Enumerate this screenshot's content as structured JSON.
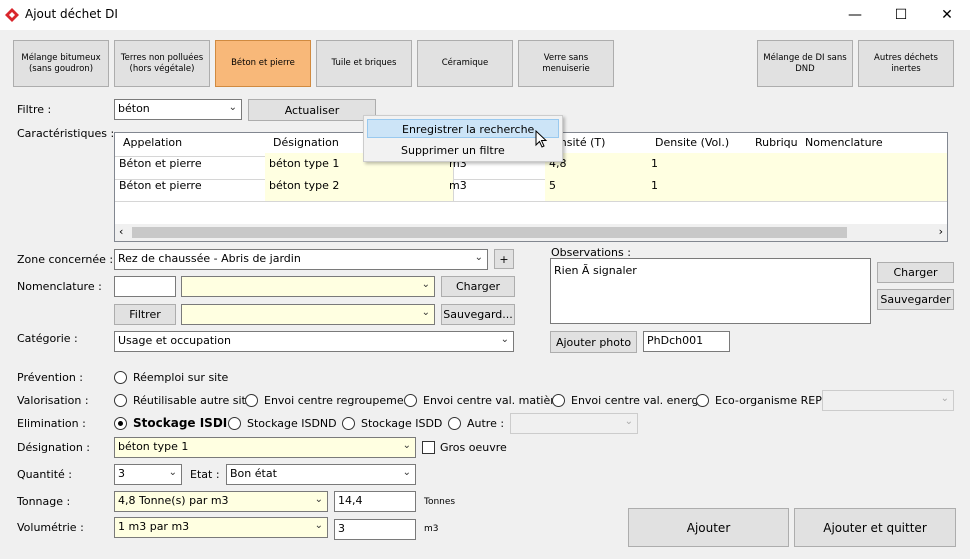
{
  "window": {
    "title": "Ajout déchet DI",
    "minimize": "—",
    "maximize": "☐",
    "close": "✕"
  },
  "categories": [
    {
      "label": "Mélange bitumeux\n(sans goudron)"
    },
    {
      "label": "Terres non polluées\n(hors végétale)"
    },
    {
      "label": "Béton et pierre"
    },
    {
      "label": "Tuile et briques"
    },
    {
      "label": "Céramique"
    },
    {
      "label": "Verre sans\nmenuiserie"
    },
    {
      "label": "Mélange de DI sans\nDND"
    },
    {
      "label": "Autres déchets\ninertes"
    }
  ],
  "filter": {
    "label": "Filtre :",
    "value": "béton",
    "refresh": "Actualiser"
  },
  "context_menu": {
    "items": [
      "Enregistrer la recherche",
      "Supprimer un filtre"
    ]
  },
  "characteristics": {
    "label": "Caractéristiques :",
    "columns": [
      "Appelation",
      "Désignation",
      "",
      "ensité (T)",
      "Densite (Vol.)",
      "Rubrique",
      "Nomenclature"
    ],
    "rows": [
      [
        "Béton et pierre",
        "béton type 1",
        "m3",
        "4,8",
        "1",
        "",
        ""
      ],
      [
        "Béton et pierre",
        "béton type 2",
        "m3",
        "5",
        "1",
        "",
        ""
      ]
    ]
  },
  "zone": {
    "label": "Zone concernée :",
    "value": "Rez de chaussée - Abris de jardin",
    "add": "+"
  },
  "nomenclature": {
    "label": "Nomenclature :",
    "code": "",
    "value": "",
    "load": "Charger",
    "filter": "Filtrer",
    "filter_value": "",
    "save": "Sauvegard..."
  },
  "observations": {
    "label": "Observations :",
    "text": "Rien Ã  signaler",
    "load": "Charger",
    "save": "Sauvegarder",
    "add_photo": "Ajouter photo",
    "photo_code": "PhDch001"
  },
  "categorie": {
    "label": "Catégorie :",
    "value": "Usage et occupation"
  },
  "prevention": {
    "label": "Prévention :",
    "options": [
      "Réemploi sur site"
    ]
  },
  "valorisation": {
    "label": "Valorisation :",
    "options": [
      "Réutilisable autre site",
      "Envoi centre regroupement",
      "Envoi centre val. matière",
      "Envoi centre val. energ.",
      "Eco-organisme REP"
    ],
    "select_value": ""
  },
  "elimination": {
    "label": "Elimination :",
    "options": [
      "Stockage ISDI",
      "Stockage ISDND",
      "Stockage ISDD",
      "Autre :"
    ],
    "selected": "Stockage ISDI",
    "autre_value": ""
  },
  "designation": {
    "label": "Désignation :",
    "value": "béton type 1",
    "gros_oeuvre": "Gros oeuvre"
  },
  "quantite": {
    "label": "Quantité :",
    "value": "3",
    "etat_label": "Etat :",
    "etat_value": "Bon état"
  },
  "tonnage": {
    "label": "Tonnage :",
    "value": "4,8 Tonne(s) par m3",
    "total": "14,4",
    "unit": "Tonnes"
  },
  "volumetrie": {
    "label": "Volumétrie :",
    "value": "1 m3 par m3",
    "total": "3",
    "unit": "m3"
  },
  "actions": {
    "add": "Ajouter",
    "add_quit": "Ajouter et quitter"
  }
}
